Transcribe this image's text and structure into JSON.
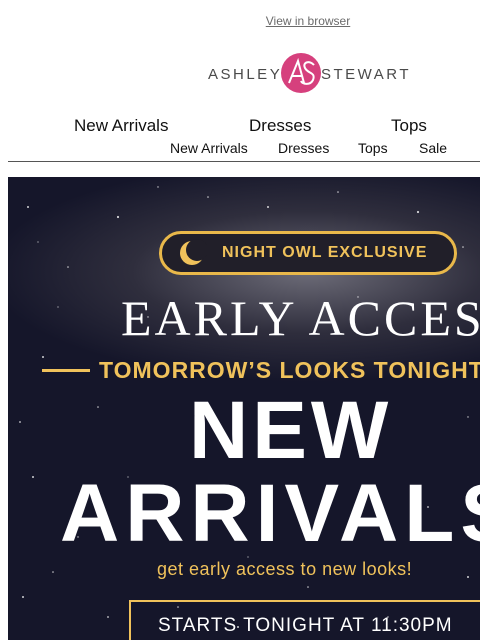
{
  "header": {
    "view_in_browser": "View in browser"
  },
  "brand": {
    "left": "ASHLEY",
    "right": "STEWART",
    "colors": {
      "mark": "#d6407d"
    }
  },
  "nav_primary": [
    {
      "label": "New Arrivals"
    },
    {
      "label": "Dresses"
    },
    {
      "label": "Tops"
    }
  ],
  "nav_secondary": [
    {
      "label": "New Arrivals"
    },
    {
      "label": "Dresses"
    },
    {
      "label": "Tops"
    },
    {
      "label": "Sale"
    }
  ],
  "hero": {
    "badge_icon": "moon-icon",
    "badge": "NIGHT OWL EXCLUSIVE",
    "headline": "EARLY ACCESS",
    "tagline": "TOMORROW’S LOOKS TONIGHT",
    "new": "NEW",
    "arrivals": "ARRIVALS",
    "subtext": "get early access to new looks!",
    "cta": "STARTS TONIGHT AT 11:30PM",
    "colors": {
      "gold": "#f0c25b",
      "night": "#15162a"
    }
  }
}
